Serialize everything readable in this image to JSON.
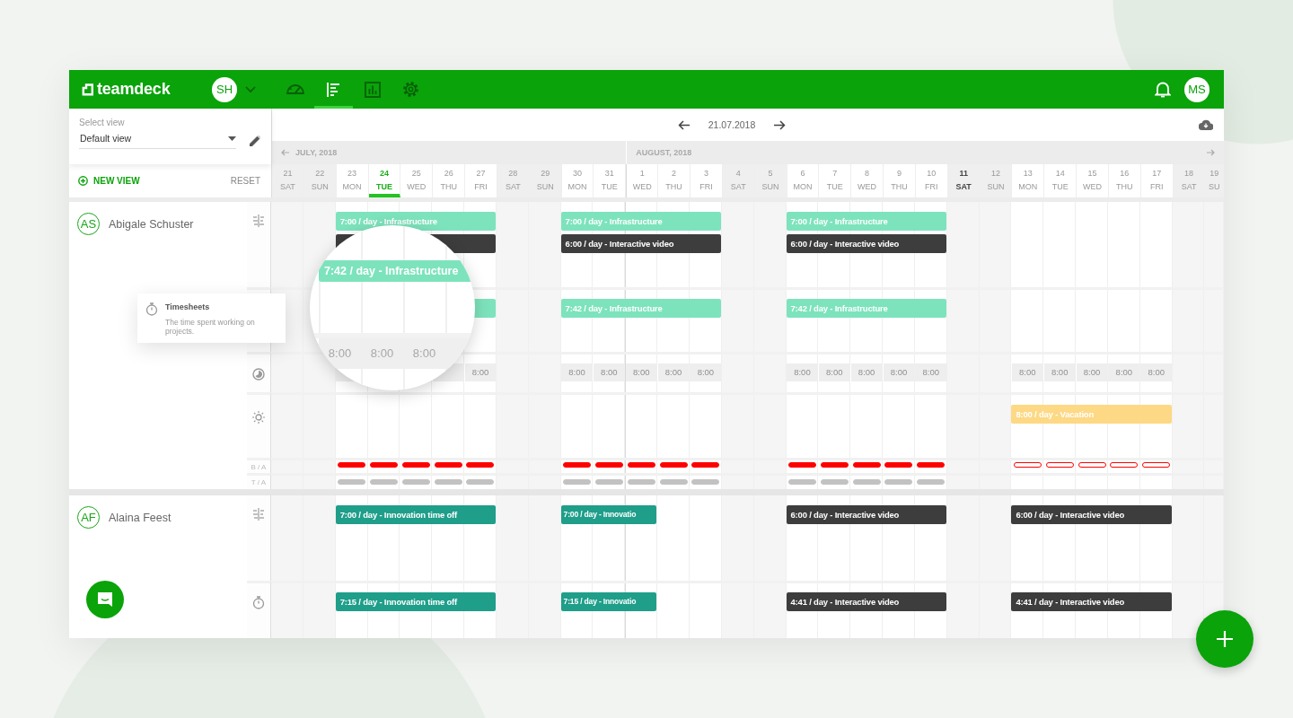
{
  "app": {
    "logo": "teamdeck",
    "account_initials": "SH",
    "user_initials": "MS"
  },
  "nav": [
    {
      "kind": "gauge",
      "selected": false
    },
    {
      "kind": "timeline",
      "selected": true
    },
    {
      "kind": "chart",
      "selected": false
    },
    {
      "kind": "settings",
      "selected": false
    }
  ],
  "view_panel": {
    "label": "Select view",
    "value": "Default view",
    "new_view": "NEW VIEW",
    "reset": "RESET"
  },
  "toolbar": {
    "date": "21.07.2018"
  },
  "months": [
    {
      "label": "JULY, 2018",
      "days": [
        {
          "date": "21",
          "weekday": "SAT",
          "weekend": true,
          "today": false,
          "bold": false
        },
        {
          "date": "22",
          "weekday": "SUN",
          "weekend": true,
          "today": false,
          "bold": false
        },
        {
          "date": "23",
          "weekday": "MON",
          "weekend": false,
          "today": false,
          "bold": false
        },
        {
          "date": "24",
          "weekday": "TUE",
          "weekend": false,
          "today": true,
          "bold": false
        },
        {
          "date": "25",
          "weekday": "WED",
          "weekend": false,
          "today": false,
          "bold": false
        },
        {
          "date": "26",
          "weekday": "THU",
          "weekend": false,
          "today": false,
          "bold": false
        },
        {
          "date": "27",
          "weekday": "FRI",
          "weekend": false,
          "today": false,
          "bold": false
        },
        {
          "date": "28",
          "weekday": "SAT",
          "weekend": true,
          "today": false,
          "bold": false
        },
        {
          "date": "29",
          "weekday": "SUN",
          "weekend": true,
          "today": false,
          "bold": false
        },
        {
          "date": "30",
          "weekday": "MON",
          "weekend": false,
          "today": false,
          "bold": false
        },
        {
          "date": "31",
          "weekday": "TUE",
          "weekend": false,
          "today": false,
          "bold": false
        }
      ]
    },
    {
      "label": "AUGUST, 2018",
      "days": [
        {
          "date": "1",
          "weekday": "WED",
          "weekend": false,
          "today": false,
          "bold": false
        },
        {
          "date": "2",
          "weekday": "THU",
          "weekend": false,
          "today": false,
          "bold": false
        },
        {
          "date": "3",
          "weekday": "FRI",
          "weekend": false,
          "today": false,
          "bold": false
        },
        {
          "date": "4",
          "weekday": "SAT",
          "weekend": true,
          "today": false,
          "bold": false
        },
        {
          "date": "5",
          "weekday": "SUN",
          "weekend": true,
          "today": false,
          "bold": false
        },
        {
          "date": "6",
          "weekday": "MON",
          "weekend": false,
          "today": false,
          "bold": false
        },
        {
          "date": "7",
          "weekday": "TUE",
          "weekend": false,
          "today": false,
          "bold": false
        },
        {
          "date": "8",
          "weekday": "WED",
          "weekend": false,
          "today": false,
          "bold": false
        },
        {
          "date": "9",
          "weekday": "THU",
          "weekend": false,
          "today": false,
          "bold": false
        },
        {
          "date": "10",
          "weekday": "FRI",
          "weekend": false,
          "today": false,
          "bold": false
        },
        {
          "date": "11",
          "weekday": "SAT",
          "weekend": true,
          "today": false,
          "bold": true
        },
        {
          "date": "12",
          "weekday": "SUN",
          "weekend": true,
          "today": false,
          "bold": false
        },
        {
          "date": "13",
          "weekday": "MON",
          "weekend": false,
          "today": false,
          "bold": false
        },
        {
          "date": "14",
          "weekday": "TUE",
          "weekend": false,
          "today": false,
          "bold": false
        },
        {
          "date": "15",
          "weekday": "WED",
          "weekend": false,
          "today": false,
          "bold": false
        },
        {
          "date": "16",
          "weekday": "THU",
          "weekend": false,
          "today": false,
          "bold": false
        },
        {
          "date": "17",
          "weekday": "FRI",
          "weekend": false,
          "today": false,
          "bold": false
        },
        {
          "date": "18",
          "weekday": "SAT",
          "weekend": true,
          "today": false,
          "bold": false
        },
        {
          "date": "19",
          "weekday": "SU",
          "weekend": true,
          "today": false,
          "bold": false
        }
      ]
    }
  ],
  "people": [
    {
      "initials": "AS",
      "name": "Abigale Schuster",
      "rows": [
        {
          "kind": "plan",
          "weeks": [
            {
              "kind": "booked",
              "bars": [
                {
                  "label": "7:00 / day - Infrastructure",
                  "color": "#7de3bd",
                  "kind": "full"
                },
                {
                  "color": "#3d3d3d",
                  "kind": "full"
                }
              ]
            },
            {
              "kind": "booked",
              "bars": [
                {
                  "label": "7:00 / day - Infrastructure",
                  "color": "#7de3bd",
                  "kind": "full"
                },
                {
                  "label": "6:00 / day - Interactive video",
                  "color": "#3d3d3d",
                  "kind": "full"
                }
              ]
            },
            {
              "kind": "booked",
              "bars": [
                {
                  "label": "7:00 / day - Infrastructure",
                  "color": "#7de3bd",
                  "kind": "full"
                },
                {
                  "label": "6:00 / day - Interactive video",
                  "color": "#3d3d3d",
                  "kind": "full"
                }
              ]
            },
            {
              "kind": "empty"
            }
          ]
        },
        {
          "kind": "timesheet",
          "weeks": [
            {
              "kind": "booked",
              "bars": [
                {
                  "color": "#7de3bd",
                  "kind": "full"
                }
              ]
            },
            {
              "kind": "booked",
              "bars": [
                {
                  "label": "7:42 / day - Infrastructure",
                  "color": "#7de3bd",
                  "kind": "full"
                }
              ]
            },
            {
              "kind": "booked",
              "bars": [
                {
                  "label": "7:42 / day - Infrastructure",
                  "color": "#7de3bd",
                  "kind": "full"
                }
              ]
            },
            {
              "kind": "empty"
            }
          ]
        },
        {
          "kind": "capacity",
          "weeks": [
            {
              "cells": [
                {},
                {},
                {},
                {},
                {
                  "label": "8:00"
                }
              ]
            },
            {
              "cells": [
                {
                  "label": "8:00"
                },
                {
                  "label": "8:00"
                },
                {
                  "label": "8:00"
                },
                {
                  "label": "8:00"
                },
                {
                  "label": "8:00"
                }
              ]
            },
            {
              "cells": [
                {
                  "label": "8:00"
                },
                {
                  "label": "8:00"
                },
                {
                  "label": "8:00"
                },
                {
                  "label": "8:00"
                },
                {
                  "label": "8:00"
                }
              ]
            },
            {
              "cells": [
                {
                  "label": "8:00"
                },
                {
                  "label": "8:00"
                },
                {
                  "label": "8:00"
                },
                {
                  "label": "8:00"
                },
                {
                  "label": "8:00"
                }
              ]
            }
          ]
        },
        {
          "kind": "vacation",
          "weeks": [
            {
              "kind": "empty"
            },
            {
              "kind": "empty"
            },
            {
              "kind": "empty"
            },
            {
              "kind": "booked",
              "bars": [
                {
                  "label": "8:00 / day - Vacation",
                  "color": "#fdd985",
                  "kind": "full"
                }
              ]
            }
          ]
        },
        {
          "kind": "balance",
          "label": "B / A",
          "weeks": [
            {
              "kind": "filled"
            },
            {
              "kind": "filled"
            },
            {
              "kind": "filled"
            },
            {
              "kind": "outline"
            }
          ]
        },
        {
          "kind": "total",
          "label": "T / A",
          "weeks": [
            {
              "kind": "filled"
            },
            {
              "kind": "filled"
            },
            {
              "kind": "filled"
            },
            {
              "kind": "empty"
            }
          ]
        }
      ]
    },
    {
      "initials": "AF",
      "name": "Alaina Feest",
      "rows": [
        {
          "kind": "plan",
          "weeks": [
            {
              "kind": "booked",
              "bars": [
                {
                  "label": "7:00 / day - Innovation time off",
                  "color": "#1f9e8a",
                  "kind": "full"
                }
              ]
            },
            {
              "kind": "booked",
              "bars": [
                {
                  "label": "7:00 / day - Innovatio",
                  "color": "#1f9e8a",
                  "kind": "short"
                }
              ]
            },
            {
              "kind": "booked",
              "bars": [
                {
                  "label": "6:00 / day - Interactive video",
                  "color": "#3d3d3d",
                  "kind": "full"
                }
              ]
            },
            {
              "kind": "booked",
              "bars": [
                {
                  "label": "6:00 / day - Interactive video",
                  "color": "#3d3d3d",
                  "kind": "full"
                }
              ]
            }
          ]
        },
        {
          "kind": "timesheet",
          "weeks": [
            {
              "kind": "booked",
              "bars": [
                {
                  "label": "7:15 / day - Innovation time off",
                  "color": "#1f9e8a",
                  "kind": "full"
                }
              ]
            },
            {
              "kind": "booked",
              "bars": [
                {
                  "label": "7:15 / day - Innovatio",
                  "color": "#1f9e8a",
                  "kind": "short"
                }
              ]
            },
            {
              "kind": "booked",
              "bars": [
                {
                  "label": "4:41 / day - Interactive video",
                  "color": "#3d3d3d",
                  "kind": "full"
                }
              ]
            },
            {
              "kind": "booked",
              "bars": [
                {
                  "label": "4:41 / day - Interactive video",
                  "color": "#3d3d3d",
                  "kind": "full"
                }
              ]
            }
          ]
        }
      ]
    }
  ],
  "tooltip": {
    "title": "Timesheets",
    "text": "The time spent working on projects."
  },
  "magnifier": {
    "bar": "7:42 / day - Infrastructure",
    "cells": [
      "8:00",
      "8:00",
      "8:00"
    ]
  }
}
